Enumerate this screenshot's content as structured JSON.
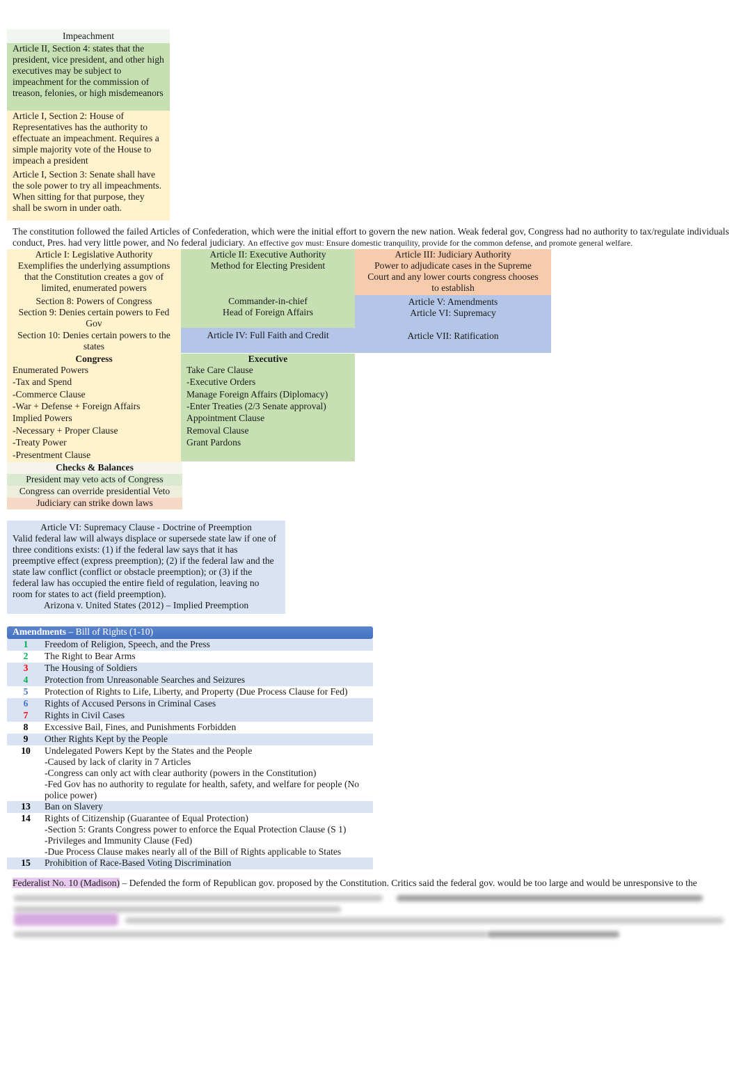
{
  "impeachment": {
    "title": "Impeachment",
    "blocks": [
      "Article II, Section 4: states that the president, vice president, and other high executives may be subject to impeachment for the commission of treason, felonies, or high misdemeanors",
      "Article I, Section 2: House of Representatives has the authority to effectuate an impeachment. Requires a simple majority vote of the House to impeach a president",
      "Article I, Section 3: Senate shall have the sole power to try all impeachments. When sitting for that purpose, they shall be sworn in under oath."
    ]
  },
  "intro": {
    "text": "The constitution followed the failed Articles of Confederation, which were the initial effort to govern the new nation. Weak federal gov, Congress had no authority to tax/regulate individuals conduct, Pres. had very little power, and No federal judiciary.",
    "effective_gov": "An effective gov must: Ensure domestic tranquility, provide for the common defense, and promote general welfare."
  },
  "articles": {
    "art1": {
      "title": "Article I: Legislative Authority",
      "desc": "Exemplifies the underlying assumptions that the Constitution creates a gov of limited, enumerated powers",
      "sec8": "Section 8: Powers of Congress",
      "sec9": "Section 9: Denies certain powers to Fed Gov",
      "sec10": "Section 10: Denies certain powers to the states"
    },
    "art2": {
      "title": "Article II: Executive Authority",
      "desc": "Method for Electing President",
      "role1": "Commander-in-chief",
      "role2": "Head of Foreign Affairs"
    },
    "art3": {
      "title": "Article III: Judiciary Authority",
      "desc": "Power to adjudicate cases in the Supreme Court and any lower courts congress chooses to establish"
    },
    "art4": "Article IV: Full Faith and Credit",
    "art5": "Article V: Amendments",
    "art6": "Article VI: Supremacy",
    "art7": "Article VII: Ratification"
  },
  "congress": {
    "title": "Congress",
    "items": [
      "Enumerated Powers",
      "-Tax and Spend",
      "-Commerce Clause",
      "-War + Defense + Foreign Affairs",
      "Implied Powers",
      "-Necessary + Proper Clause",
      "-Treaty Power",
      "-Presentment Clause"
    ]
  },
  "executive": {
    "title": "Executive",
    "items": [
      "Take Care Clause",
      "-Executive Orders",
      "Manage Foreign Affairs (Diplomacy)",
      "-Enter Treaties (2/3 Senate approval)",
      "Appointment Clause",
      "Removal Clause",
      "Grant Pardons"
    ]
  },
  "checks": {
    "title": "Checks & Balances",
    "items": [
      "President may veto acts of Congress",
      "Congress can override presidential Veto",
      "Judiciary can strike down laws"
    ]
  },
  "supremacy": {
    "title": "Article VI: Supremacy Clause - Doctrine of Preemption",
    "body": "Valid federal law will always displace or supersede state law if one of three conditions exists: (1) if the federal law says that it has preemptive effect (express preemption); (2) if the federal law and the state law conflict (conflict or obstacle preemption); or (3) if the federal law has occupied the entire field of regulation, leaving no room for states to act (field preemption).",
    "case": "Arizona v. United States (2012) – Implied Preemption"
  },
  "amendments": {
    "header_bold": "Amendments",
    "header_rest": " – Bill of Rights (1-10)",
    "rows": [
      {
        "num": "1",
        "text": "Freedom of Religion, Speech, and the Press",
        "color": "#00b050"
      },
      {
        "num": "2",
        "text": "The Right to Bear Arms",
        "color": "#00b050"
      },
      {
        "num": "3",
        "text": "The Housing of Soldiers",
        "color": "#ff0000"
      },
      {
        "num": "4",
        "text": "Protection from Unreasonable Searches and Seizures",
        "color": "#00b050"
      },
      {
        "num": "5",
        "text": "Protection of Rights to Life, Liberty, and Property (Due Process Clause for Fed)",
        "color": "#4472c4"
      },
      {
        "num": "6",
        "text": "Rights of Accused Persons in Criminal Cases",
        "color": "#4472c4"
      },
      {
        "num": "7",
        "text": "Rights in Civil Cases",
        "color": "#ff0000"
      },
      {
        "num": "8",
        "text": "Excessive Bail, Fines, and Punishments Forbidden",
        "color": "#000000"
      },
      {
        "num": "9",
        "text": "Other Rights Kept by the People",
        "color": "#000000"
      },
      {
        "num": "10",
        "text": "Undelegated Powers Kept by the States and the People",
        "color": "#000000",
        "subs": [
          "-Caused by lack of clarity in 7 Articles",
          "-Congress can only act with clear authority (powers in the Constitution)",
          "-Fed Gov has no authority to regulate for health, safety, and welfare for people (No police power)"
        ]
      },
      {
        "num": "13",
        "text": "Ban on Slavery",
        "color": "#000000"
      },
      {
        "num": "14",
        "text": "Rights of Citizenship (Guarantee of Equal Protection)",
        "color": "#000000",
        "subs": [
          "-Section 5: Grants Congress power to enforce the Equal Protection Clause (S 1)",
          "-Privileges and Immunity Clause (Fed)",
          "-Due Process Clause makes nearly all of the Bill of Rights applicable to States"
        ]
      },
      {
        "num": "15",
        "text": "Prohibition of Race-Based Voting Discrimination",
        "color": "#000000"
      }
    ]
  },
  "federalist": {
    "highlight": "Federalist No. 10 (Madison)",
    "text": " – Defended the form of Republican gov. proposed by the Constitution. Critics said the federal gov. would be too large and would be unresponsive to the"
  }
}
